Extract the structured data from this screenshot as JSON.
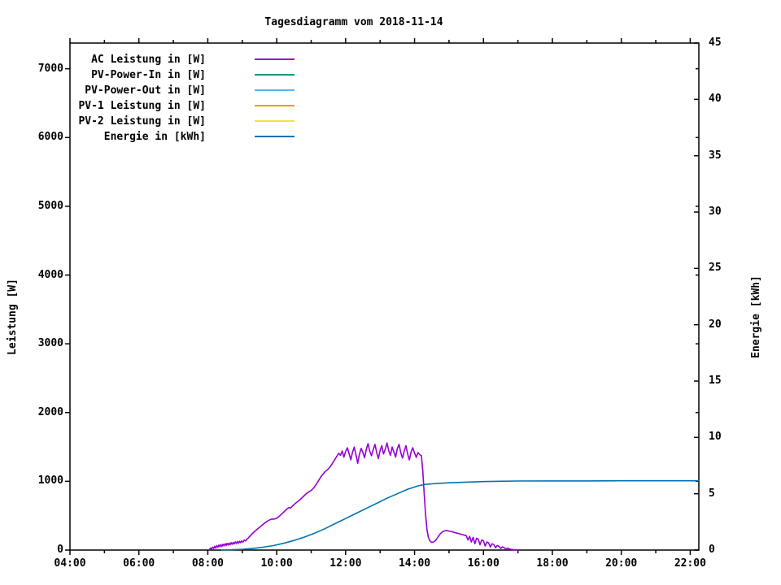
{
  "title": "Tagesdiagramm vom 2018-11-14",
  "axes": {
    "left_label": "Leistung [W]",
    "right_label": "Energie [kWh]",
    "x_major": [
      {
        "hour": 4,
        "label": "04:00"
      },
      {
        "hour": 6,
        "label": "06:00"
      },
      {
        "hour": 8,
        "label": "08:00"
      },
      {
        "hour": 10,
        "label": "10:00"
      },
      {
        "hour": 12,
        "label": "12:00"
      },
      {
        "hour": 14,
        "label": "14:00"
      },
      {
        "hour": 16,
        "label": "16:00"
      },
      {
        "hour": 18,
        "label": "18:00"
      },
      {
        "hour": 20,
        "label": "20:00"
      },
      {
        "hour": 22,
        "label": "22:00"
      }
    ],
    "x_minor_hours": [
      5,
      7,
      9,
      11,
      13,
      15,
      17,
      19,
      21
    ],
    "y_left_ticks": [
      0,
      1000,
      2000,
      3000,
      4000,
      5000,
      6000,
      7000
    ],
    "y_right_ticks": [
      0,
      5,
      10,
      15,
      20,
      25,
      30,
      35,
      40,
      45
    ]
  },
  "legend": [
    {
      "label": "AC Leistung in [W]",
      "color": "#9400d3"
    },
    {
      "label": "PV-Power-In in [W]",
      "color": "#009e73"
    },
    {
      "label": "PV-Power-Out in [W]",
      "color": "#56b4e9"
    },
    {
      "label": "PV-1 Leistung in [W]",
      "color": "#e69f00"
    },
    {
      "label": "PV-2 Leistung in [W]",
      "color": "#f0e442"
    },
    {
      "label": "Energie in [kWh]",
      "color": "#0072b2"
    }
  ],
  "chart_data": {
    "type": "line",
    "title": "Tagesdiagramm vom 2018-11-14",
    "xlabel": "",
    "ylabel_left": "Leistung [W]",
    "ylabel_right": "Energie [kWh]",
    "x_range_hours": [
      4,
      22.25
    ],
    "y_left_range": [
      0,
      7374
    ],
    "y_right_range": [
      0,
      45
    ],
    "grid": false,
    "legend_position": "top-left-inside",
    "series": [
      {
        "name": "AC Leistung in [W]",
        "color": "#9400d3",
        "axis": "left",
        "unit": "W",
        "points": [
          [
            8.05,
            8
          ],
          [
            8.08,
            30
          ],
          [
            8.11,
            14
          ],
          [
            8.14,
            42
          ],
          [
            8.17,
            22
          ],
          [
            8.2,
            55
          ],
          [
            8.23,
            30
          ],
          [
            8.26,
            65
          ],
          [
            8.29,
            40
          ],
          [
            8.32,
            72
          ],
          [
            8.35,
            48
          ],
          [
            8.38,
            80
          ],
          [
            8.41,
            52
          ],
          [
            8.44,
            85
          ],
          [
            8.47,
            60
          ],
          [
            8.5,
            92
          ],
          [
            8.53,
            65
          ],
          [
            8.56,
            98
          ],
          [
            8.59,
            72
          ],
          [
            8.62,
            102
          ],
          [
            8.65,
            78
          ],
          [
            8.68,
            108
          ],
          [
            8.71,
            84
          ],
          [
            8.74,
            112
          ],
          [
            8.77,
            90
          ],
          [
            8.8,
            118
          ],
          [
            8.83,
            95
          ],
          [
            8.86,
            124
          ],
          [
            8.89,
            100
          ],
          [
            8.92,
            128
          ],
          [
            8.95,
            106
          ],
          [
            8.98,
            132
          ],
          [
            9.02,
            115
          ],
          [
            9.06,
            145
          ],
          [
            9.1,
            132
          ],
          [
            9.14,
            160
          ],
          [
            9.18,
            178
          ],
          [
            9.22,
            200
          ],
          [
            9.26,
            222
          ],
          [
            9.3,
            243
          ],
          [
            9.35,
            268
          ],
          [
            9.4,
            288
          ],
          [
            9.45,
            310
          ],
          [
            9.5,
            330
          ],
          [
            9.55,
            352
          ],
          [
            9.6,
            372
          ],
          [
            9.65,
            392
          ],
          [
            9.7,
            410
          ],
          [
            9.75,
            428
          ],
          [
            9.8,
            440
          ],
          [
            9.85,
            452
          ],
          [
            9.9,
            448
          ],
          [
            9.95,
            455
          ],
          [
            10.0,
            462
          ],
          [
            10.05,
            482
          ],
          [
            10.1,
            505
          ],
          [
            10.15,
            528
          ],
          [
            10.2,
            552
          ],
          [
            10.25,
            575
          ],
          [
            10.3,
            598
          ],
          [
            10.35,
            618
          ],
          [
            10.4,
            612
          ],
          [
            10.45,
            638
          ],
          [
            10.5,
            660
          ],
          [
            10.55,
            682
          ],
          [
            10.6,
            702
          ],
          [
            10.65,
            722
          ],
          [
            10.7,
            745
          ],
          [
            10.75,
            768
          ],
          [
            10.8,
            792
          ],
          [
            10.85,
            815
          ],
          [
            10.9,
            838
          ],
          [
            10.95,
            852
          ],
          [
            11.0,
            866
          ],
          [
            11.05,
            892
          ],
          [
            11.1,
            920
          ],
          [
            11.15,
            958
          ],
          [
            11.2,
            1000
          ],
          [
            11.25,
            1040
          ],
          [
            11.3,
            1078
          ],
          [
            11.35,
            1108
          ],
          [
            11.4,
            1138
          ],
          [
            11.45,
            1160
          ],
          [
            11.5,
            1182
          ],
          [
            11.55,
            1212
          ],
          [
            11.6,
            1248
          ],
          [
            11.65,
            1288
          ],
          [
            11.7,
            1328
          ],
          [
            11.75,
            1368
          ],
          [
            11.8,
            1408
          ],
          [
            11.85,
            1378
          ],
          [
            11.9,
            1442
          ],
          [
            11.95,
            1352
          ],
          [
            12.0,
            1432
          ],
          [
            12.05,
            1488
          ],
          [
            12.1,
            1402
          ],
          [
            12.15,
            1312
          ],
          [
            12.2,
            1422
          ],
          [
            12.25,
            1498
          ],
          [
            12.3,
            1382
          ],
          [
            12.35,
            1262
          ],
          [
            12.4,
            1392
          ],
          [
            12.45,
            1478
          ],
          [
            12.5,
            1422
          ],
          [
            12.55,
            1342
          ],
          [
            12.6,
            1468
          ],
          [
            12.65,
            1548
          ],
          [
            12.7,
            1438
          ],
          [
            12.75,
            1372
          ],
          [
            12.8,
            1458
          ],
          [
            12.85,
            1538
          ],
          [
            12.9,
            1418
          ],
          [
            12.95,
            1332
          ],
          [
            13.0,
            1448
          ],
          [
            13.05,
            1518
          ],
          [
            13.1,
            1398
          ],
          [
            13.15,
            1468
          ],
          [
            13.2,
            1558
          ],
          [
            13.25,
            1448
          ],
          [
            13.3,
            1378
          ],
          [
            13.35,
            1498
          ],
          [
            13.4,
            1428
          ],
          [
            13.45,
            1352
          ],
          [
            13.5,
            1478
          ],
          [
            13.55,
            1538
          ],
          [
            13.6,
            1418
          ],
          [
            13.65,
            1338
          ],
          [
            13.7,
            1438
          ],
          [
            13.75,
            1518
          ],
          [
            13.8,
            1398
          ],
          [
            13.85,
            1312
          ],
          [
            13.9,
            1428
          ],
          [
            13.95,
            1488
          ],
          [
            14.0,
            1408
          ],
          [
            14.05,
            1348
          ],
          [
            14.1,
            1418
          ],
          [
            14.15,
            1388
          ],
          [
            14.2,
            1372
          ],
          [
            14.24,
            1150
          ],
          [
            14.28,
            820
          ],
          [
            14.32,
            520
          ],
          [
            14.36,
            300
          ],
          [
            14.4,
            185
          ],
          [
            14.45,
            130
          ],
          [
            14.5,
            112
          ],
          [
            14.55,
            118
          ],
          [
            14.6,
            135
          ],
          [
            14.65,
            168
          ],
          [
            14.7,
            205
          ],
          [
            14.75,
            238
          ],
          [
            14.8,
            262
          ],
          [
            14.85,
            276
          ],
          [
            14.9,
            283
          ],
          [
            14.95,
            281
          ],
          [
            15.0,
            277
          ],
          [
            15.05,
            272
          ],
          [
            15.1,
            266
          ],
          [
            15.15,
            258
          ],
          [
            15.2,
            251
          ],
          [
            15.25,
            244
          ],
          [
            15.3,
            237
          ],
          [
            15.35,
            230
          ],
          [
            15.4,
            223
          ],
          [
            15.45,
            216
          ],
          [
            15.5,
            209
          ],
          [
            15.55,
            148
          ],
          [
            15.6,
            198
          ],
          [
            15.65,
            118
          ],
          [
            15.7,
            186
          ],
          [
            15.75,
            92
          ],
          [
            15.8,
            172
          ],
          [
            15.85,
            158
          ],
          [
            15.9,
            78
          ],
          [
            15.95,
            148
          ],
          [
            16.0,
            132
          ],
          [
            16.05,
            58
          ],
          [
            16.1,
            118
          ],
          [
            16.15,
            104
          ],
          [
            16.2,
            44
          ],
          [
            16.25,
            92
          ],
          [
            16.3,
            78
          ],
          [
            16.35,
            34
          ],
          [
            16.4,
            66
          ],
          [
            16.45,
            54
          ],
          [
            16.5,
            24
          ],
          [
            16.55,
            46
          ],
          [
            16.6,
            36
          ],
          [
            16.65,
            14
          ],
          [
            16.7,
            28
          ],
          [
            16.75,
            18
          ],
          [
            16.8,
            10
          ],
          [
            16.9,
            5
          ],
          [
            17.0,
            1
          ]
        ]
      },
      {
        "name": "PV-Power-In in [W]",
        "color": "#009e73",
        "axis": "left",
        "unit": "W",
        "visible": false,
        "points": []
      },
      {
        "name": "PV-Power-Out in [W]",
        "color": "#56b4e9",
        "axis": "left",
        "unit": "W",
        "visible": false,
        "points": []
      },
      {
        "name": "PV-1 Leistung in [W]",
        "color": "#e69f00",
        "axis": "left",
        "unit": "W",
        "visible": false,
        "points": []
      },
      {
        "name": "PV-2 Leistung in [W]",
        "color": "#f0e442",
        "axis": "left",
        "unit": "W",
        "visible": false,
        "points": []
      },
      {
        "name": "Energie in [kWh]",
        "color": "#0072b2",
        "axis": "right",
        "unit": "kWh",
        "points": [
          [
            8.4,
            0.0
          ],
          [
            8.7,
            0.03
          ],
          [
            9.0,
            0.07
          ],
          [
            9.3,
            0.14
          ],
          [
            9.6,
            0.25
          ],
          [
            9.9,
            0.4
          ],
          [
            10.2,
            0.6
          ],
          [
            10.5,
            0.85
          ],
          [
            10.8,
            1.15
          ],
          [
            11.1,
            1.5
          ],
          [
            11.4,
            1.9
          ],
          [
            11.7,
            2.35
          ],
          [
            12.0,
            2.8
          ],
          [
            12.3,
            3.25
          ],
          [
            12.6,
            3.7
          ],
          [
            12.9,
            4.15
          ],
          [
            13.2,
            4.6
          ],
          [
            13.5,
            5.0
          ],
          [
            13.8,
            5.4
          ],
          [
            14.1,
            5.7
          ],
          [
            14.3,
            5.82
          ],
          [
            14.5,
            5.88
          ],
          [
            14.75,
            5.93
          ],
          [
            15.0,
            5.97
          ],
          [
            15.5,
            6.03
          ],
          [
            16.0,
            6.08
          ],
          [
            16.5,
            6.11
          ],
          [
            17.0,
            6.13
          ],
          [
            18.0,
            6.14
          ],
          [
            19.0,
            6.14
          ],
          [
            20.0,
            6.15
          ],
          [
            21.0,
            6.15
          ],
          [
            22.0,
            6.15
          ],
          [
            22.25,
            6.15
          ]
        ]
      }
    ]
  }
}
